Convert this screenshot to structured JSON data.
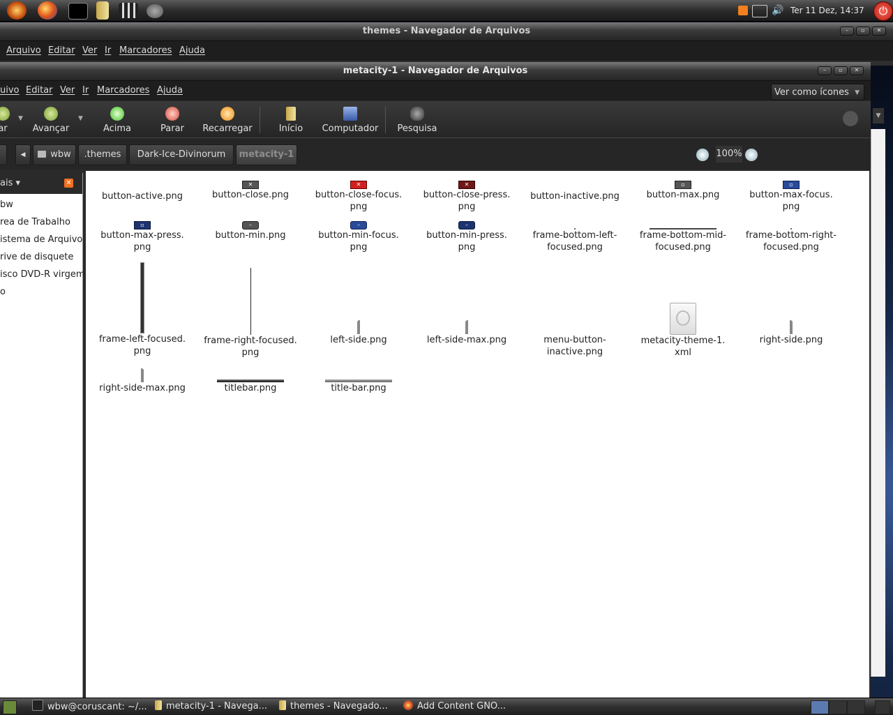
{
  "top_panel": {
    "launchers": [
      "ubuntu-menu-icon",
      "firefox-icon",
      "terminal-icon",
      "files-icon",
      "video-icon",
      "gimp-icon"
    ],
    "clock": "Ter 11 Dez, 14:37"
  },
  "back_window": {
    "title": "themes - Navegador de Arquivos",
    "menu": [
      "Arquivo",
      "Editar",
      "Ver",
      "Ir",
      "Marcadores",
      "Ajuda"
    ]
  },
  "front_window": {
    "title": "metacity-1 - Navegador de Arquivos",
    "menu": [
      "uivo",
      "Editar",
      "Ver",
      "Ir",
      "Marcadores",
      "Ajuda"
    ],
    "toolbar": {
      "back": "ar",
      "forward": "Avançar",
      "up": "Acima",
      "stop": "Parar",
      "reload": "Recarregar",
      "home": "Início",
      "computer": "Computador",
      "search": "Pesquisa"
    },
    "breadcrumbs": [
      "wbw",
      ".themes",
      "Dark-Ice-Divinorum",
      "metacity-1"
    ],
    "zoom": "100%",
    "view_mode": "Ver como ícones",
    "sidebar": {
      "header": "ais",
      "items": [
        "bw",
        "rea de Trabalho",
        "istema de Arquivo",
        "rive de disquete",
        "isco DVD-R virgem",
        "o"
      ]
    },
    "files": [
      "button-active.png",
      "button-close.png",
      "button-close-focus.\npng",
      "button-close-press.\npng",
      "button-inactive.png",
      "button-max.png",
      "button-max-focus.\npng",
      "button-max-press.\npng",
      "button-min.png",
      "button-min-focus.\npng",
      "button-min-press.\npng",
      "frame-bottom-left-\nfocused.png",
      "frame-bottom-mid-\nfocused.png",
      "frame-bottom-right-\nfocused.png",
      "frame-left-focused.\npng",
      "frame-right-focused.\npng",
      "left-side.png",
      "left-side-max.png",
      "menu-button-\ninactive.png",
      "metacity-theme-1.\nxml",
      "right-side.png",
      "right-side-max.png",
      "titlebar.png",
      "title-bar.png"
    ]
  },
  "taskbar": [
    "wbw@coruscant: ~/...",
    "metacity-1 - Navega...",
    "themes - Navegado...",
    "Add Content GNO..."
  ],
  "colors": {
    "panel": "#2c2c2c",
    "close_red": "#d02020",
    "focus_blue": "#2a4a9a"
  }
}
